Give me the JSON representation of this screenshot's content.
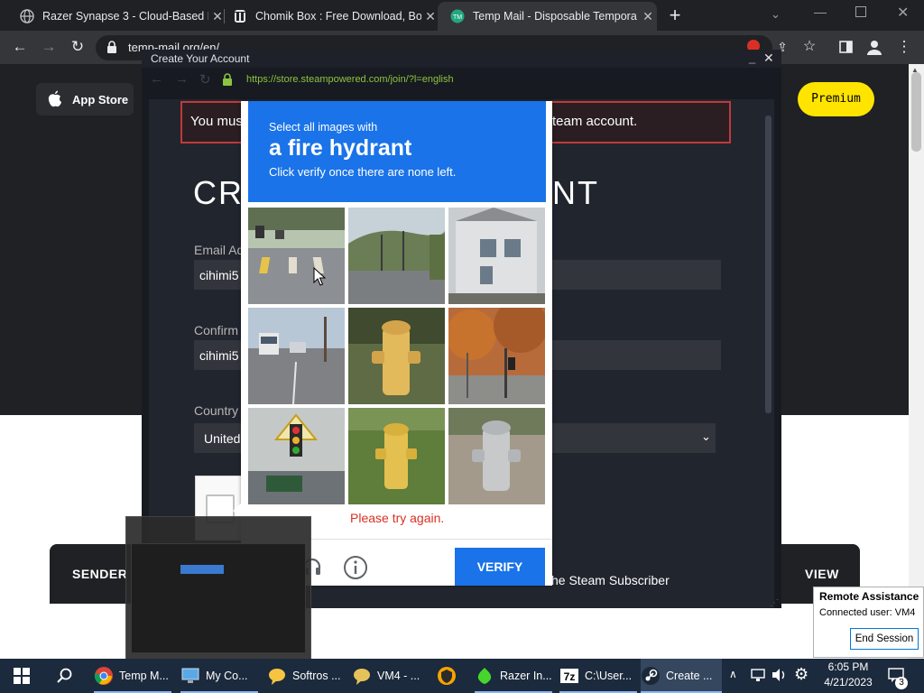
{
  "browser": {
    "tabs": [
      {
        "title": "Razer Synapse 3 - Cloud-Based H",
        "favicon": "globe-icon"
      },
      {
        "title": "Chomik Box : Free Download, Bo",
        "favicon": "archive-org-icon"
      },
      {
        "title": "Temp Mail - Disposable Tempora",
        "favicon": "tempmail-icon"
      }
    ],
    "new_tab": "+",
    "url_fragment": "temp-mail.org/en/"
  },
  "site": {
    "app_store_label": "App Store",
    "premium_label": "Premium",
    "sender_label": "SENDER",
    "view_label": "VIEW"
  },
  "steam_popup": {
    "window_title": "Create Your Account",
    "url": "https://store.steampowered.com/join/?l=english",
    "notice_left": "You mus",
    "notice_right": "team account.",
    "heading_left": "CRE",
    "heading_right": "NT",
    "email_label": "Email Ad",
    "email_value": "cihimi5",
    "confirm_label": "Confirm",
    "confirm_value": "cihimi5",
    "country_label": "Country",
    "country_value": "United",
    "subscriber_text": "he Steam Subscriber"
  },
  "captcha": {
    "prompt_small": "Select all images with",
    "prompt_big": "a fire hydrant",
    "prompt_sub": "Click verify once there are none left.",
    "error_text": "Please try again.",
    "verify_label": "VERIFY"
  },
  "remote_assistance": {
    "title": "Remote Assistance",
    "connected": "Connected user:  VM4",
    "end_session": "End Session"
  },
  "taskbar": {
    "items": [
      {
        "label": "Temp M..."
      },
      {
        "label": "My Co..."
      },
      {
        "label": "Softros ..."
      },
      {
        "label": "VM4 - ..."
      },
      {
        "label": ""
      },
      {
        "label": "Razer In..."
      },
      {
        "label": "C:\\User..."
      },
      {
        "label": "Create ..."
      }
    ],
    "time": "6:05 PM",
    "date": "4/21/2023",
    "notification_count": "3"
  },
  "colors": {
    "captcha_blue": "#1a73e8",
    "steam_bg": "#171a21",
    "premium_yellow": "#ffe400",
    "error_red": "#d93025"
  }
}
